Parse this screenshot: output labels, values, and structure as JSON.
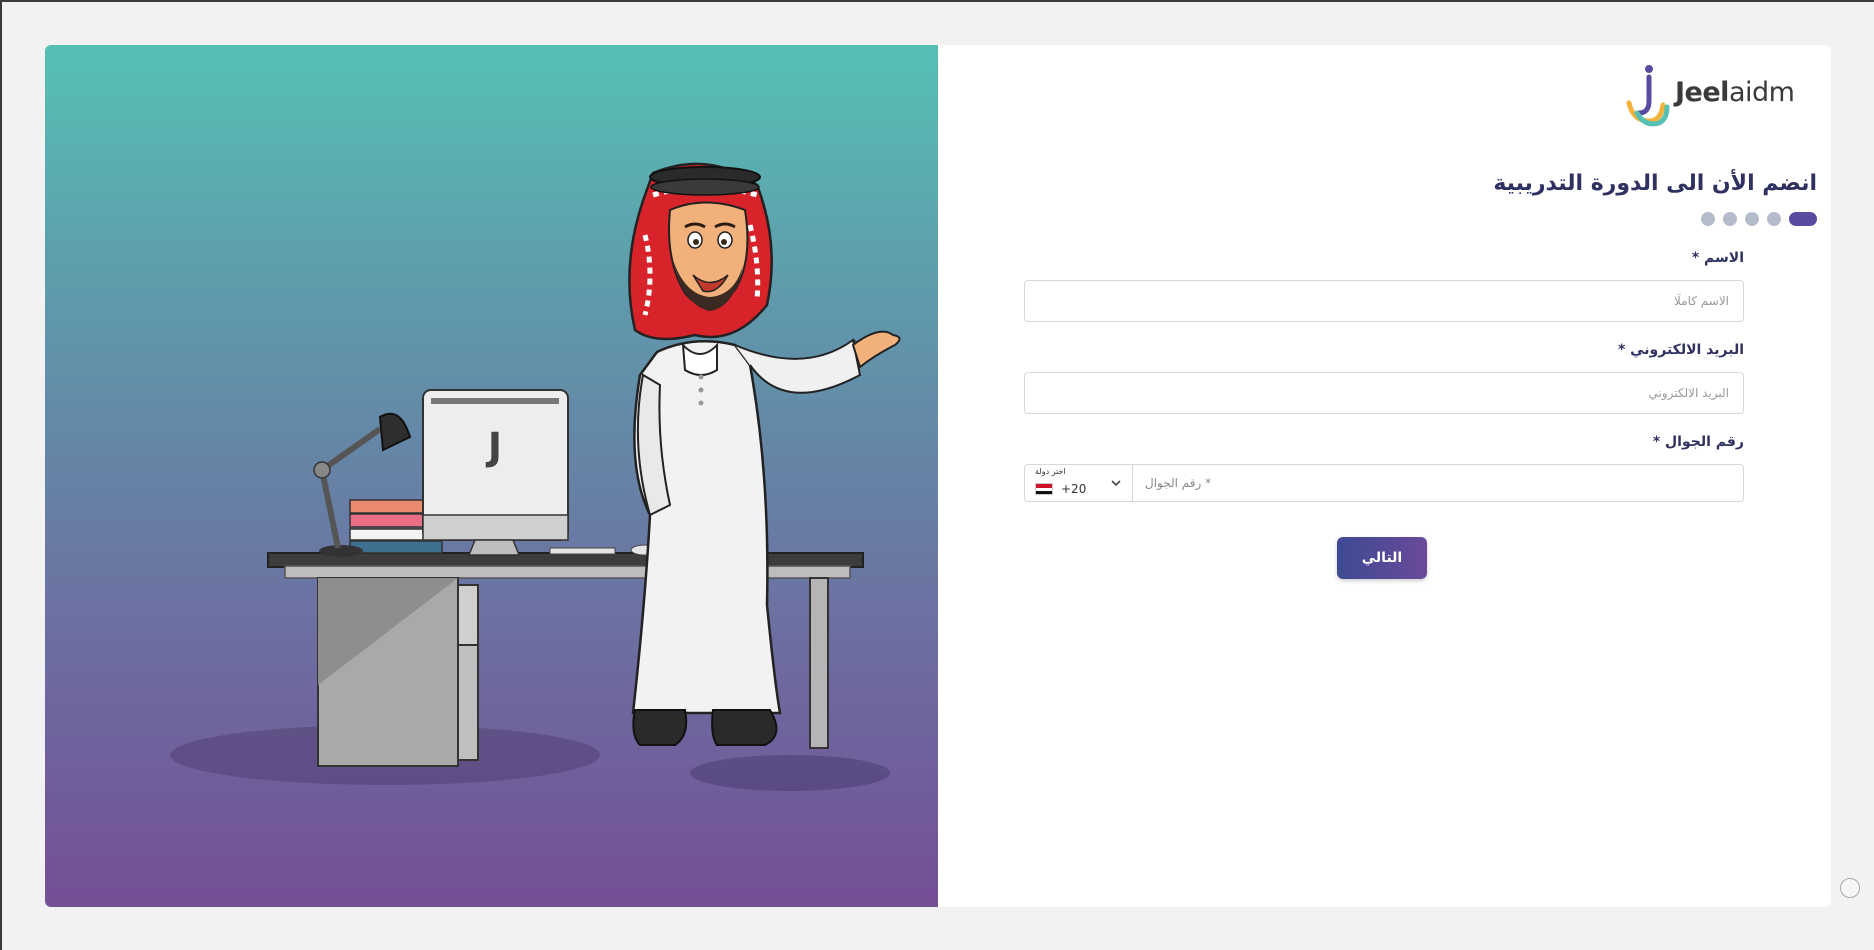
{
  "brand": {
    "logo_bold": "Jeel",
    "logo_light": "aidm",
    "colors": {
      "purple": "#5a4aa0",
      "teal": "#56c0b3",
      "yellow": "#f2b33d"
    }
  },
  "hero": {
    "illustration": "man-in-thobe-at-desk-illustration"
  },
  "form": {
    "title": "انضم الأن الى الدورة التدريبية",
    "steps_total": 5,
    "steps_current": 1,
    "name": {
      "label": "الاسم *",
      "placeholder": "الاسم كاملًا",
      "value": ""
    },
    "email": {
      "label": "البريد الالكتروني *",
      "placeholder": "البريد الالكتروني",
      "value": ""
    },
    "phone": {
      "label": "رقم الجوال *",
      "country_caption": "اختر دولة",
      "dial_code": "+20",
      "placeholder": "* رقم الجوال",
      "value": ""
    },
    "next_label": "التالي"
  }
}
